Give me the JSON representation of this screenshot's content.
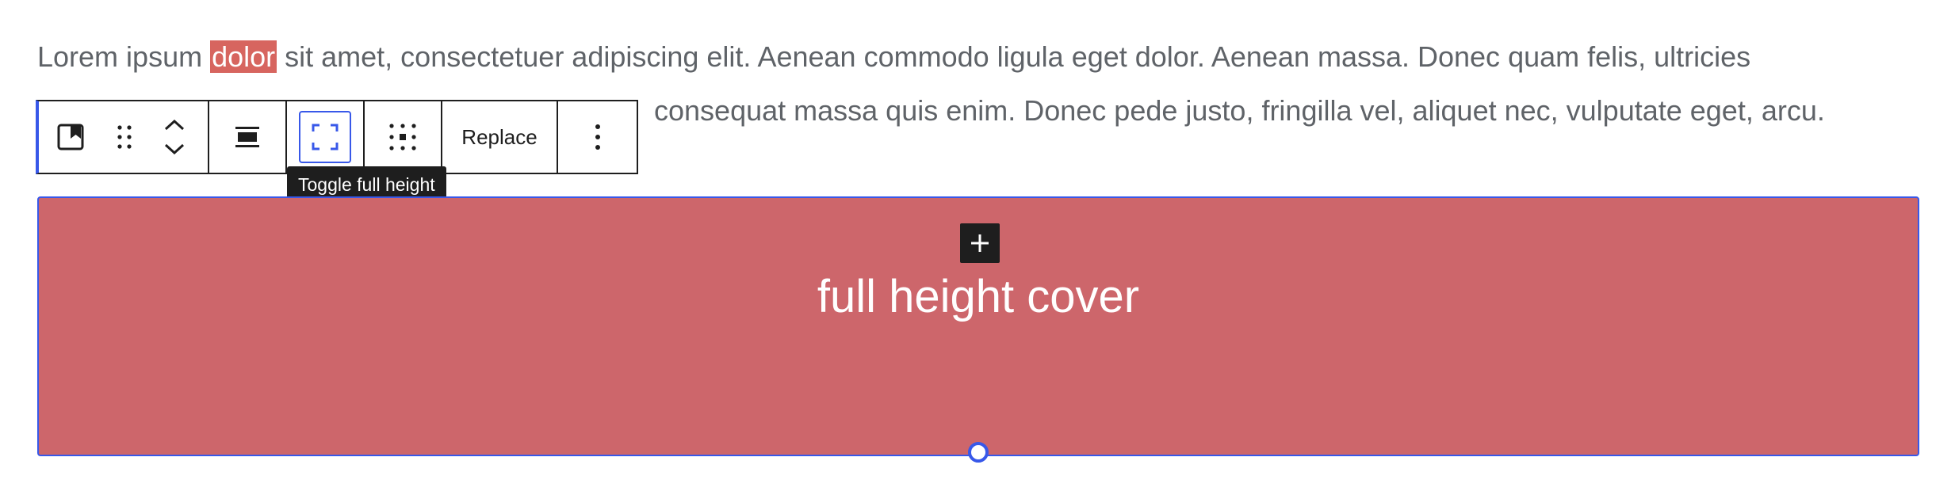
{
  "paragraph": {
    "line1_before": "Lorem ipsum ",
    "line1_highlight": "dolor",
    "line1_after": " sit amet, consectetuer adipiscing elit. Aenean commodo ligula eget dolor. Aenean massa. Donec quam felis, ultricies",
    "line2_visible": "consequat massa quis enim. Donec pede justo, fringilla vel, aliquet nec, vulputate eget, arcu."
  },
  "toolbar": {
    "block_type_icon": "cover-block-icon",
    "drag_icon": "drag-handle-icon",
    "move_up_icon": "chevron-up-icon",
    "move_down_icon": "chevron-down-icon",
    "align_icon": "align-wide-icon",
    "full_height_icon": "full-height-icon",
    "position_icon": "content-position-icon",
    "replace_label": "Replace",
    "more_icon": "more-vertical-icon"
  },
  "tooltip": {
    "text": "Toggle full height"
  },
  "cover": {
    "title": "full height cover",
    "background_color": "#cd666b",
    "accent_color": "#3858e9",
    "inserter_icon": "plus-icon"
  }
}
